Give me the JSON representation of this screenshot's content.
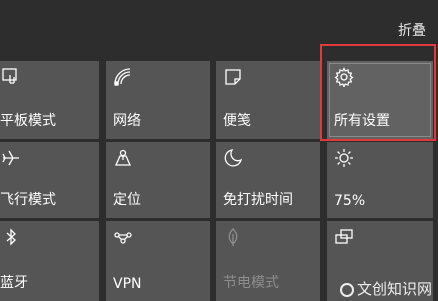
{
  "header": {
    "collapse_label": "折叠"
  },
  "tiles": [
    {
      "label": "平板模式",
      "icon": "tablet-mode-icon"
    },
    {
      "label": "网络",
      "icon": "network-icon"
    },
    {
      "label": "便笺",
      "icon": "note-icon"
    },
    {
      "label": "所有设置",
      "icon": "gear-icon"
    },
    {
      "label": "飞行模式",
      "icon": "airplane-icon"
    },
    {
      "label": "定位",
      "icon": "location-icon"
    },
    {
      "label": "免打扰时间",
      "icon": "moon-icon"
    },
    {
      "label": "75%",
      "icon": "brightness-icon"
    },
    {
      "label": "蓝牙",
      "icon": "bluetooth-icon"
    },
    {
      "label": "VPN",
      "icon": "vpn-icon"
    },
    {
      "label": "节电模式",
      "icon": "battery-saver-icon",
      "disabled": true
    },
    {
      "label": "",
      "icon": "project-icon"
    }
  ],
  "watermark": {
    "text": "文创知识网"
  },
  "colors": {
    "highlight": "#e23a3a",
    "tile": "#555555",
    "background": "#2d2d2d"
  }
}
